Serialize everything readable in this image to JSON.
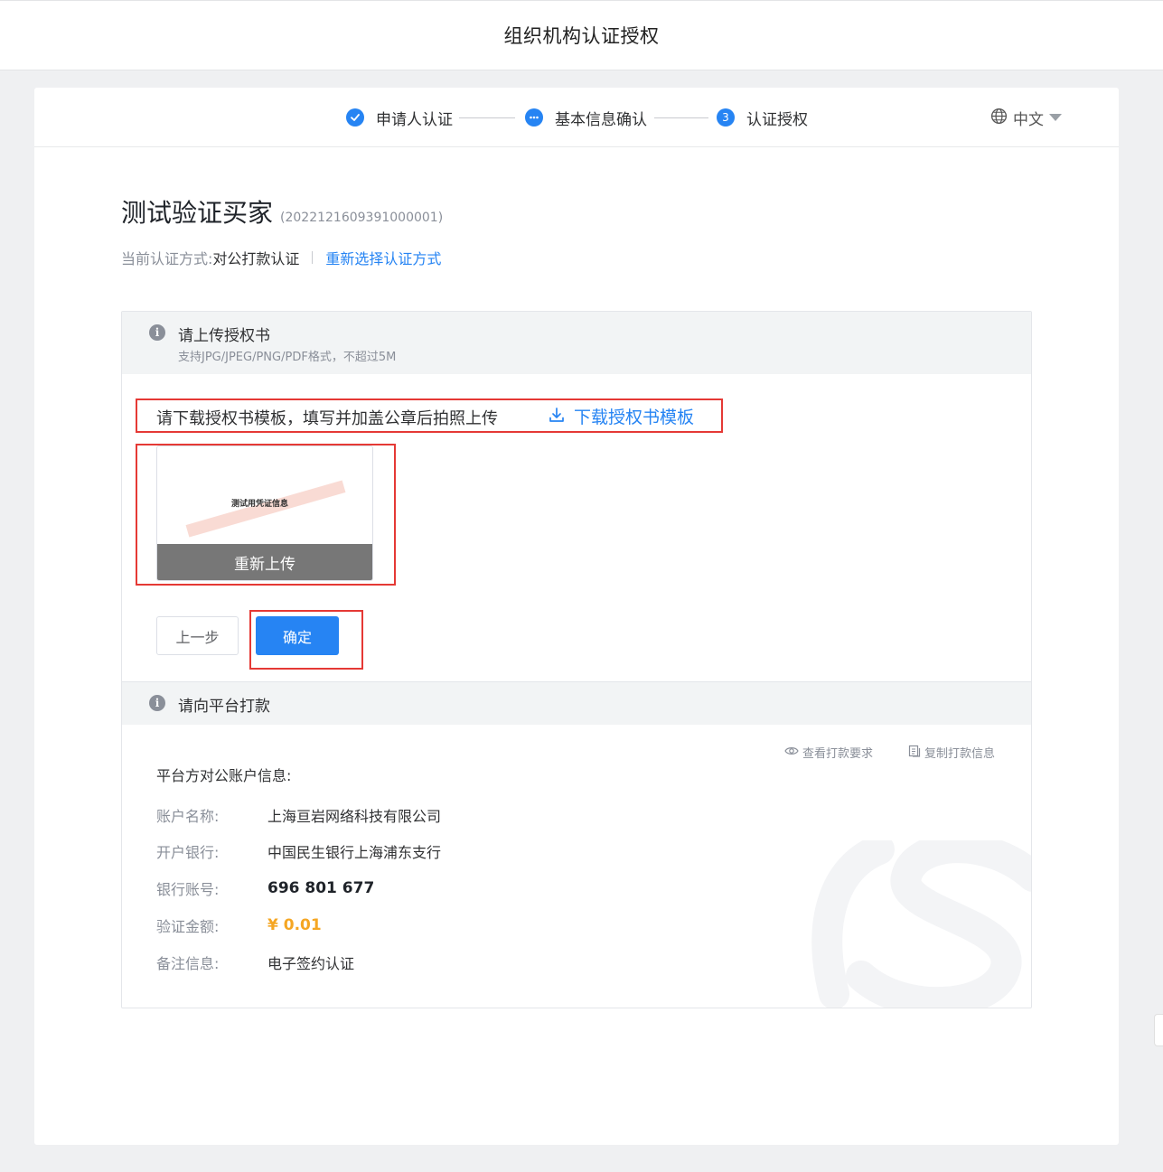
{
  "header": {
    "title": "组织机构认证授权"
  },
  "steps": [
    {
      "index": "1",
      "label": "申请人认证",
      "status": "done"
    },
    {
      "index": "2",
      "label": "基本信息确认",
      "status": "done"
    },
    {
      "index": "3",
      "label": "认证授权",
      "status": "current"
    }
  ],
  "language": {
    "label": "中文"
  },
  "company": {
    "name": "测试验证买家",
    "code": "(2022121609391000001)"
  },
  "method": {
    "label": "当前认证方式:",
    "value": "对公打款认证",
    "reselect_link": "重新选择认证方式"
  },
  "upload_section": {
    "title": "请上传授权书",
    "subtitle": "支持JPG/JPEG/PNG/PDF格式，不超过5M",
    "instruction": "请下载授权书模板，填写并加盖公章后拍照上传",
    "download_link": "下载授权书模板",
    "thumbnail_text": "测试用凭证信息",
    "reupload_label": "重新上传"
  },
  "buttons": {
    "prev_label": "上一步",
    "confirm_label": "确定"
  },
  "payment_section": {
    "title": "请向平台打款",
    "view_requirements": "查看打款要求",
    "copy_info": "复制打款信息",
    "account_title": "平台方对公账户信息:",
    "rows": [
      {
        "key": "账户名称:",
        "value": "上海亘岩网络科技有限公司"
      },
      {
        "key": "开户银行:",
        "value": "中国民生银行上海浦东支行"
      },
      {
        "key": "银行账号:",
        "value": "696 801 677"
      },
      {
        "key": "验证金额:",
        "value": "¥ 0.01"
      },
      {
        "key": "备注信息:",
        "value": "电子签约认证"
      }
    ]
  },
  "colors": {
    "primary": "#2684f3",
    "highlight_border": "#e53935",
    "amount": "#f5a623"
  }
}
